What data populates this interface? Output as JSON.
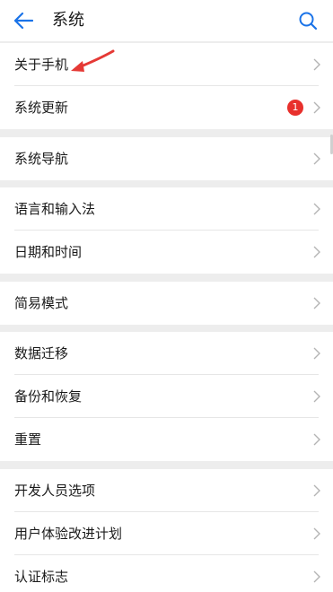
{
  "header": {
    "title": "系统"
  },
  "groups": [
    {
      "items": [
        {
          "label": "关于手机"
        },
        {
          "label": "系统更新",
          "badge": "1"
        }
      ]
    },
    {
      "items": [
        {
          "label": "系统导航"
        }
      ]
    },
    {
      "items": [
        {
          "label": "语言和输入法"
        },
        {
          "label": "日期和时间"
        }
      ]
    },
    {
      "items": [
        {
          "label": "简易模式"
        }
      ]
    },
    {
      "items": [
        {
          "label": "数据迁移"
        },
        {
          "label": "备份和恢复"
        },
        {
          "label": "重置"
        }
      ]
    },
    {
      "items": [
        {
          "label": "开发人员选项"
        },
        {
          "label": "用户体验改进计划"
        },
        {
          "label": "认证标志"
        }
      ]
    }
  ],
  "colors": {
    "accent": "#1a73e8",
    "badge": "#e8302c",
    "annotation_arrow": "#e53935"
  }
}
